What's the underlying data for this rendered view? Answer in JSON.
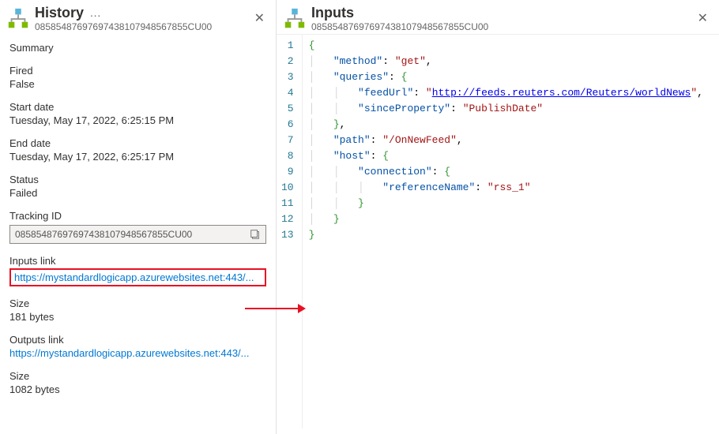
{
  "history": {
    "title": "History",
    "subtitle": "08585487697697438107948567855CU00",
    "summary_label": "Summary",
    "fired_label": "Fired",
    "fired_value": "False",
    "start_label": "Start date",
    "start_value": "Tuesday, May 17, 2022, 6:25:15 PM",
    "end_label": "End date",
    "end_value": "Tuesday, May 17, 2022, 6:25:17 PM",
    "status_label": "Status",
    "status_value": "Failed",
    "tracking_label": "Tracking ID",
    "tracking_value": "08585487697697438107948567855CU00",
    "inputs_link_label": "Inputs link",
    "inputs_link_value": "https://mystandardlogicapp.azurewebsites.net:443/...",
    "inputs_size_label": "Size",
    "inputs_size_value": "181 bytes",
    "outputs_link_label": "Outputs link",
    "outputs_link_value": "https://mystandardlogicapp.azurewebsites.net:443/...",
    "outputs_size_label": "Size",
    "outputs_size_value": "1082 bytes"
  },
  "inputs": {
    "title": "Inputs",
    "subtitle": "08585487697697438107948567855CU00",
    "code": {
      "method_key": "\"method\"",
      "method_val": "\"get\"",
      "queries_key": "\"queries\"",
      "feedUrl_key": "\"feedUrl\"",
      "feedUrl_val": "\"http://feeds.reuters.com/Reuters/worldNews\"",
      "since_key": "\"sinceProperty\"",
      "since_val": "\"PublishDate\"",
      "path_key": "\"path\"",
      "path_val": "\"/OnNewFeed\"",
      "host_key": "\"host\"",
      "conn_key": "\"connection\"",
      "ref_key": "\"referenceName\"",
      "ref_val": "\"rss_1\"",
      "line_numbers": [
        "1",
        "2",
        "3",
        "4",
        "5",
        "6",
        "7",
        "8",
        "9",
        "10",
        "11",
        "12",
        "13"
      ]
    }
  }
}
